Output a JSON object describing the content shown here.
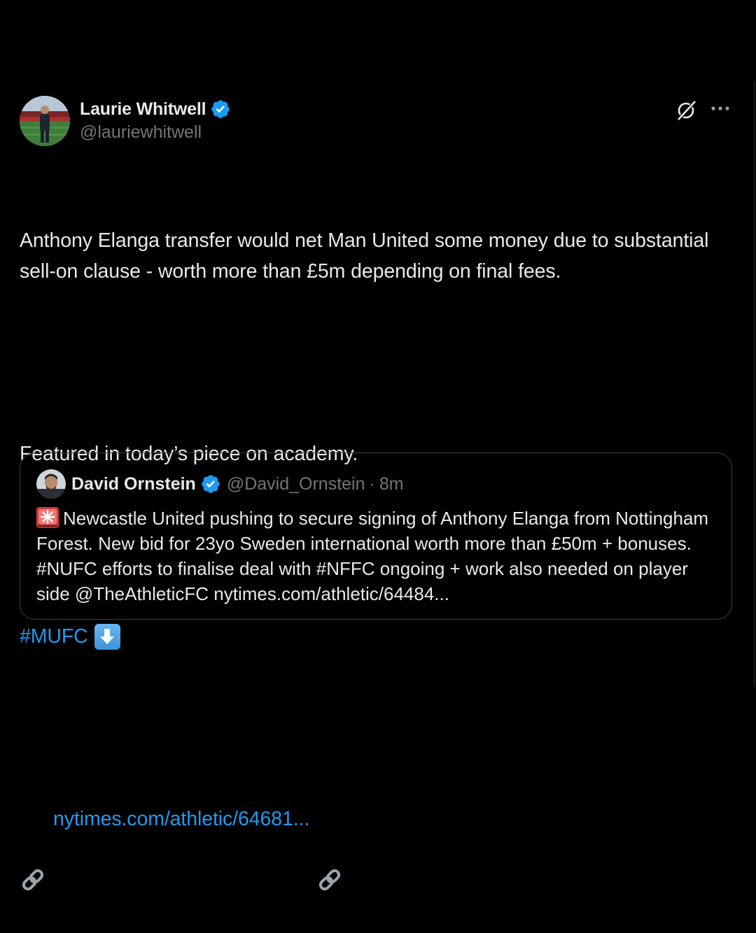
{
  "colors": {
    "background": "#000000",
    "text": "#e7e9ea",
    "muted": "#71767b",
    "link": "#1d9bf0",
    "verified": "#1d9bf0",
    "border": "#3e4144"
  },
  "tweet": {
    "author": {
      "display_name": "Laurie Whitwell",
      "handle": "@lauriewhitwell",
      "verified_icon": "verified-badge-icon",
      "avatar": "avatar-photo"
    },
    "actions": {
      "grok_icon": "grok-icon",
      "more_icon": "more-options-icon"
    },
    "text": {
      "paragraph1": "Anthony Elanga transfer would net Man United some money due to substantial sell-on clause - worth more than £5m depending on final fees.",
      "paragraph2": "Featured in today’s piece on academy.",
      "hashtag": "#MUFC",
      "hashtag_emoji": "down-arrow-emoji",
      "link_icon": "link-emoji",
      "link_url": "nytimes.com/athletic/64681..."
    }
  },
  "quoted_tweet": {
    "author": {
      "display_name": "David Ornstein",
      "handle": "@David_Ornstein",
      "separator": "·",
      "time": "8m",
      "verified_icon": "verified-badge-icon"
    },
    "text": {
      "emoji": "siren-emoji",
      "body": "Newcastle United pushing to secure signing of Anthony Elanga from Nottingham Forest. New bid for 23yo Sweden international worth more than £50m + bonuses. #NUFC efforts to finalise deal with #NFFC ongoing + work also needed on player side @TheAthleticFC nytimes.com/athletic/64484..."
    }
  }
}
